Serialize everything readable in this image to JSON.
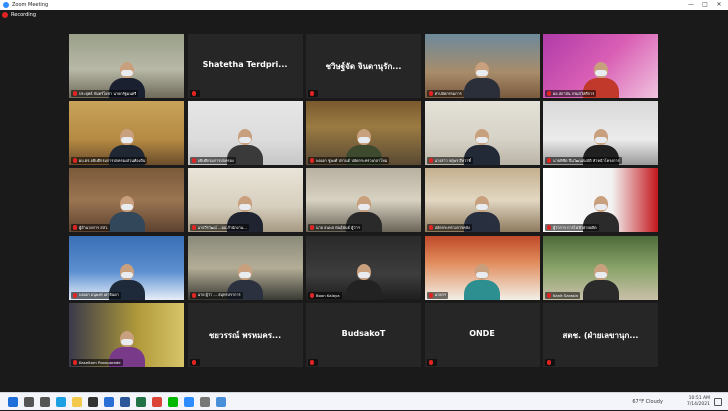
{
  "window": {
    "title": "Zoom Meeting",
    "controls": [
      "—",
      "□",
      "✕"
    ]
  },
  "recording": {
    "label": "Recording",
    "color": "#e02424"
  },
  "active_speaker_color": "#c6e02e",
  "tiles": [
    {
      "name": "ประยุทธ์ จันทร์โอชา นายกรัฐมนตรี",
      "big": "",
      "scene": "linear-gradient(180deg,#9aa08a 0%,#b8b9a6 55%,#6f6a5a 100%)",
      "body": "#1a2030",
      "active": true
    },
    {
      "name": "",
      "big": "Shatetha Terdpri...",
      "scene": "#262626",
      "body": ""
    },
    {
      "name": "",
      "big": "ชวิษฐ์จัด จินดานุรัก...",
      "scene": "#262626",
      "body": ""
    },
    {
      "name": "ท่าปลัดกรรมการ",
      "big": "",
      "scene": "linear-gradient(180deg,#6d8a9c 0%,#a88c6a 60%,#7a5a3e 100%)",
      "body": "#2a2f3a"
    },
    {
      "name": "ผอ.สถาบัน กรมสวัสดีการ",
      "big": "",
      "scene": "linear-gradient(135deg,#b03aa8 0%,#d95fb5 50%,#f0c3de 100%)",
      "body": "#c0392b"
    },
    {
      "name": "ผบ.ตร.อธิบดีกรมการปกครองส่วนท้องถิ่น",
      "big": "",
      "scene": "linear-gradient(180deg,#c9a35a 0%,#b58a43 60%,#6b4d2b 100%)",
      "body": "#1f2733"
    },
    {
      "name": "อธิบดีกรมการปกครอง",
      "big": "",
      "scene": "linear-gradient(180deg,#e6e6e6 0%,#dcdcdc 60%,#c6c6c6 100%)",
      "body": "#3a3a3a"
    },
    {
      "name": "พลเอก ชูพงศ์ ปรานต์ ปลัดกระทรวงกลาโหม",
      "big": "",
      "scene": "linear-gradient(180deg,#7a5a2e 0%,#9b7b42 40%,#5a4a34 100%)",
      "body": "#3d4a2e"
    },
    {
      "name": "นางสาว จตุพร สีหวาทิ์",
      "big": "",
      "scene": "linear-gradient(180deg,#e4e1d8 0%,#d6d2c6 60%,#b9b4a6 100%)",
      "body": "#222a38"
    },
    {
      "name": "นายพิชิต ปิ่นวัฒนสมบัติ หัวหน้าโครงการ",
      "big": "",
      "scene": "linear-gradient(180deg,#d9d9d9 0%,#ececec 60%,#9a9a9a 100%)",
      "body": "#202020"
    },
    {
      "name": "ผู้อำนวยการ สสว.",
      "big": "",
      "scene": "linear-gradient(180deg,#7a5a3a 0%,#9b7552 50%,#5e4330 100%)",
      "body": "#33475b"
    },
    {
      "name": "นายวีรวัฒน์ ...ผอ.สำนักงาน...",
      "big": "",
      "scene": "linear-gradient(180deg,#e9e4d8 0%,#d7cfbe 60%,#a69a82 100%)",
      "body": "#1f2430"
    },
    {
      "name": "นาย ธนพล พันธุ์พันธ์ ผู้ว่าฯ",
      "big": "",
      "scene": "linear-gradient(180deg,#b8b1a2 0%,#d8d2c2 50%,#6a6458 100%)",
      "body": "#2a2a2a"
    },
    {
      "name": "ปลัดกระทรวงการคลัง",
      "big": "",
      "scene": "linear-gradient(180deg,#c4b08e 0%,#e2d7c2 50%,#8e7b5e 100%)",
      "body": "#283040"
    },
    {
      "name": "ผู้ว่าการ การไฟฟ้าฝ่ายผลิต",
      "big": "",
      "scene": "linear-gradient(90deg,#ffffff 0%,#f2f2f2 60%,#c4161c 100%)",
      "body": "#2b2b2b"
    },
    {
      "name": "พลเอก อนุพงษ์ เผ่าจินดา",
      "big": "",
      "scene": "linear-gradient(180deg,#3b6fb6 0%,#5b8fd0 55%,#e6eef8 100%)",
      "body": "#1e2a3a"
    },
    {
      "name": "นาย ผู้ว่า ... สมุทรปราการ",
      "big": "",
      "scene": "linear-gradient(180deg,#8a8a7a 0%,#b3ad96 50%,#3a3a34 100%)",
      "body": "#2c3140"
    },
    {
      "name": "Boon Kalaya",
      "big": "",
      "scene": "linear-gradient(180deg,#2a2a2a 0%,#3d3d3d 60%,#1e1e1e 100%)",
      "body": "#222"
    },
    {
      "name": "นายกฯ",
      "big": "",
      "scene": "linear-gradient(180deg,#c04a2a 0%,#e08a5a 40%,#f2efe6 100%)",
      "body": "#2d8f8f"
    },
    {
      "name": "Kanit Sarasin",
      "big": "",
      "scene": "linear-gradient(180deg,#4e6b3a 0%,#8aa36a 50%,#c8c0a8 100%)",
      "body": "#2a2a2a"
    },
    {
      "name": "Kaseltorn Poonparade",
      "big": "",
      "scene": "linear-gradient(90deg,#3a3a4a 0%,#b09a3a 60%,#d8c46a 100%)",
      "body": "#7a3a8a"
    },
    {
      "name": "",
      "big": "ชยวรรณ์ พรหมคร...",
      "scene": "#262626",
      "body": ""
    },
    {
      "name": "",
      "big": "BudsakoT",
      "scene": "#262626",
      "body": ""
    },
    {
      "name": "",
      "big": "ONDE",
      "scene": "#262626",
      "body": ""
    },
    {
      "name": "",
      "big": "สตช. (ฝ่ายเลขานุก...",
      "scene": "#262626",
      "body": ""
    }
  ],
  "taskbar": {
    "icons": [
      "start-icon",
      "search-icon",
      "task-view-icon",
      "edge-icon",
      "explorer-icon",
      "store-icon",
      "mail-icon",
      "word-icon",
      "excel-icon",
      "chrome-icon",
      "line-icon",
      "zoom-icon",
      "settings-icon",
      "photos-icon"
    ],
    "weather": "67°F  Cloudy",
    "time": "10:51 AM",
    "date": "7/14/2021"
  }
}
